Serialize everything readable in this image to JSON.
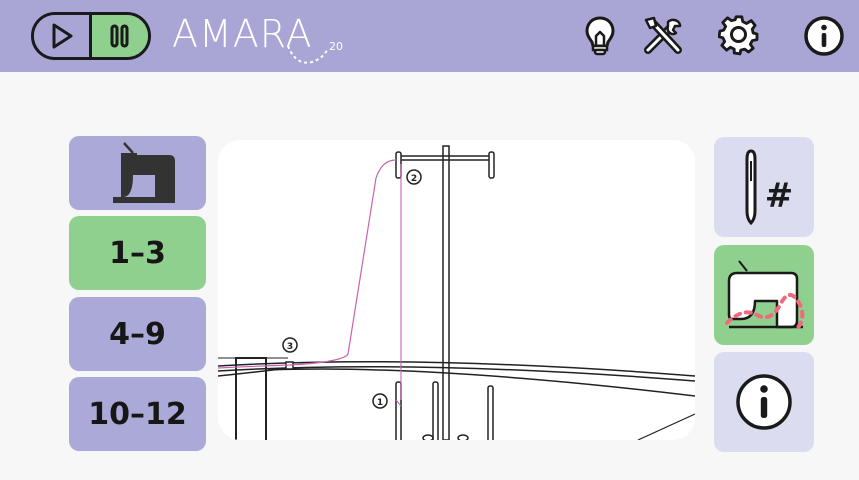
{
  "colors": {
    "topbar": "#a9a6d6",
    "button_lavender": "#aba9d8",
    "button_selected_green": "#8fd08e",
    "button_light": "#dcdcf0",
    "thread_pink": "#c963b1",
    "dots_red": "#f06a7d"
  },
  "header": {
    "logo_text": "AMARA",
    "logo_subscript": "20",
    "play_icon": "play-icon",
    "pause_icon": "pause-icon",
    "icons": [
      "lightbulb-icon",
      "tools-icon",
      "gear-icon",
      "info-icon"
    ]
  },
  "steps": {
    "machine_icon": "sewing-machine-icon",
    "groups": [
      {
        "label": "1–3",
        "selected": true
      },
      {
        "label": "4–9",
        "selected": false
      },
      {
        "label": "10–12",
        "selected": false
      }
    ]
  },
  "diagram": {
    "step_markers": [
      "1",
      "2",
      "3"
    ]
  },
  "right_panel": {
    "needle_icon": "needle-hash-icon",
    "needle_hash": "#",
    "machine_stitch_icon": "machine-stitch-icon",
    "info_icon": "info-icon"
  }
}
